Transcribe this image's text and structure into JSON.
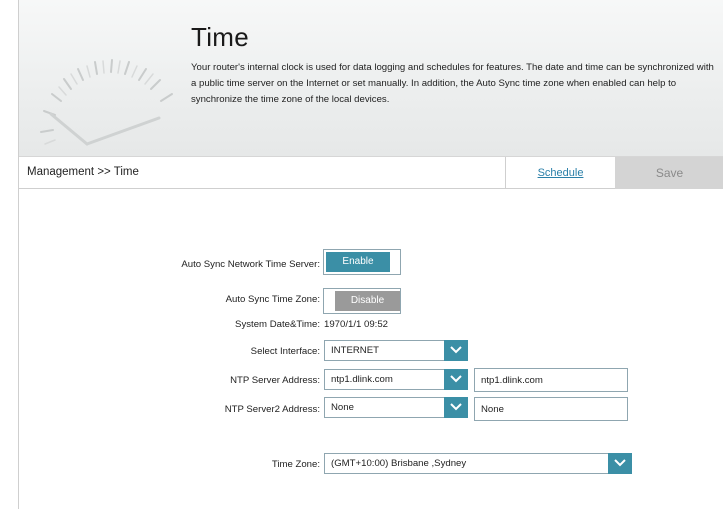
{
  "header": {
    "title": "Time",
    "description": "Your router's internal clock is used for data logging and schedules for features. The date and time can be synchronized with a public time server on the Internet or set manually. In addition, the Auto Sync time zone when enabled can help to synchronize the time zone of the local devices."
  },
  "nav": {
    "breadcrumb": "Management >> Time",
    "schedule_label": "Schedule",
    "save_label": "Save"
  },
  "form": {
    "auto_sync_ntp": {
      "label": "Auto Sync Network Time Server:",
      "state_label": "Enable"
    },
    "auto_sync_tz": {
      "label": "Auto Sync Time Zone:",
      "state_label": "Disable"
    },
    "system_datetime": {
      "label": "System Date&Time:",
      "value": "1970/1/1 09:52"
    },
    "select_interface": {
      "label": "Select Interface:",
      "value": "INTERNET"
    },
    "ntp_server": {
      "label": "NTP Server Address:",
      "select_value": "ntp1.dlink.com",
      "input_value": "ntp1.dlink.com"
    },
    "ntp_server2": {
      "label": "NTP Server2 Address:",
      "select_value": "None",
      "input_value": "None"
    },
    "time_zone": {
      "label": "Time Zone:",
      "value": "(GMT+10:00) Brisbane ,Sydney"
    }
  },
  "colors": {
    "accent": "#3b8fa6",
    "disabled": "#9a9a9a",
    "link": "#2a7fa8"
  },
  "icons": {
    "dropdown": "chevron-down-icon",
    "banner": "clock-gauge-icon"
  }
}
